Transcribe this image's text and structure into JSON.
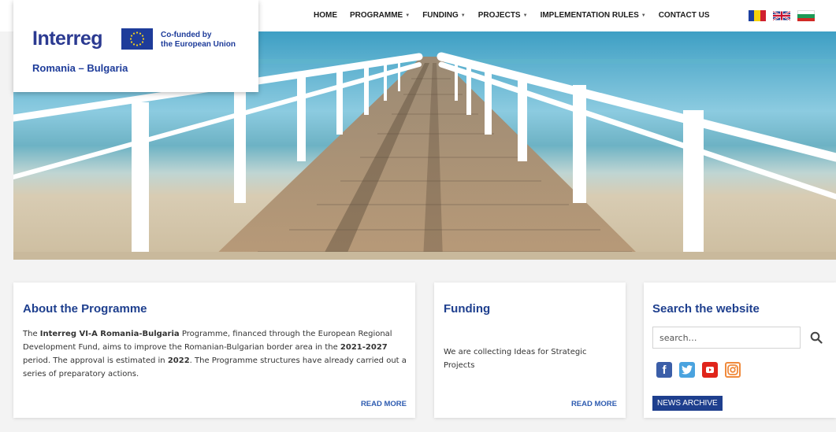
{
  "brand": {
    "logo_text": "Interreg",
    "cofunded_line1": "Co-funded by",
    "cofunded_line2": "the European Union",
    "region": "Romania – Bulgaria"
  },
  "nav": {
    "items": [
      {
        "label": "HOME",
        "dropdown": false
      },
      {
        "label": "PROGRAMME",
        "dropdown": true
      },
      {
        "label": "FUNDING",
        "dropdown": true
      },
      {
        "label": "PROJECTS",
        "dropdown": true
      },
      {
        "label": "IMPLEMENTATION RULES",
        "dropdown": true
      },
      {
        "label": "CONTACT US",
        "dropdown": false
      }
    ],
    "languages": [
      "romania-flag",
      "uk-flag",
      "bulgaria-flag"
    ]
  },
  "about": {
    "title": "About the Programme",
    "t1": "The ",
    "b1": "Interreg VI-A Romania-Bulgaria",
    "t2": " Programme, financed through  the European Regional Development Fund, aims  to improve the Romanian-Bulgarian border area in the ",
    "b2": "2021-2027",
    "t3": " period. The approval is estimated in ",
    "b3": "2022",
    "t4": ". The Programme structures have already carried out  a series of preparatory actions.",
    "read_more": "READ MORE"
  },
  "funding": {
    "title": "Funding",
    "text": "We are collecting Ideas for Strategic Projects",
    "read_more": "READ MORE"
  },
  "search": {
    "title": "Search the website",
    "placeholder": "search…",
    "news_archive": "NEWS ARCHIVE"
  },
  "social": [
    {
      "icon": "facebook-icon",
      "glyph": "f",
      "color": "#3b5ea8"
    },
    {
      "icon": "twitter-icon",
      "glyph": "t",
      "color": "#4aa3df"
    },
    {
      "icon": "youtube-icon",
      "glyph": "▶",
      "color": "#e0251b"
    },
    {
      "icon": "instagram-icon",
      "glyph": "◎",
      "color": "#f08a3c"
    }
  ],
  "colors": {
    "brand_blue": "#1e3f8e",
    "link_blue": "#2d5bb0"
  }
}
